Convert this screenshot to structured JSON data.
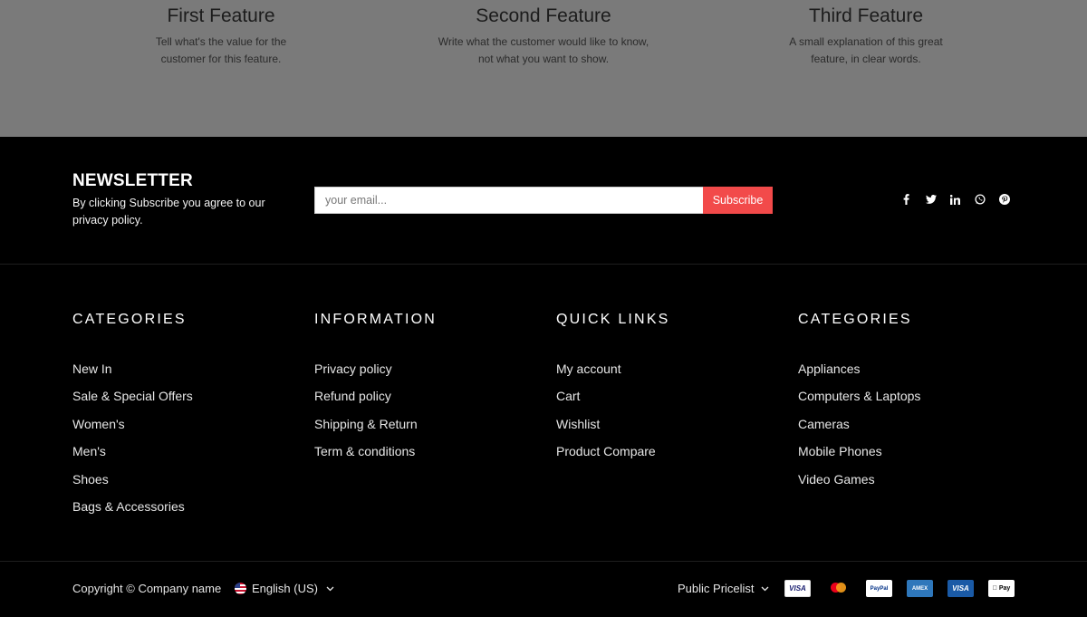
{
  "features": [
    {
      "title": "First Feature",
      "text": "Tell what's the value for the customer for this feature."
    },
    {
      "title": "Second Feature",
      "text": "Write what the customer would like to know, not what you want to show."
    },
    {
      "title": "Third Feature",
      "text": "A small explanation of this great feature, in clear words."
    }
  ],
  "newsletter": {
    "title": "NEWSLETTER",
    "text": "By clicking Subscribe you agree to our privacy policy.",
    "placeholder": "your email...",
    "button": "Subscribe"
  },
  "social": [
    "facebook-icon",
    "twitter-icon",
    "linkedin-icon",
    "whatsapp-icon",
    "pinterest-icon"
  ],
  "columns": [
    {
      "title": "CATEGORIES",
      "items": [
        "New In",
        "Sale & Special Offers",
        "Women's",
        "Men's",
        "Shoes",
        "Bags & Accessories"
      ]
    },
    {
      "title": "INFORMATION",
      "items": [
        "Privacy policy",
        "Refund policy",
        "Shipping & Return",
        "Term & conditions"
      ]
    },
    {
      "title": "QUICK LINKS",
      "items": [
        "My account",
        "Cart",
        "Wishlist",
        "Product Compare"
      ]
    },
    {
      "title": "CATEGORIES",
      "items": [
        "Appliances",
        "Computers & Laptops",
        "Cameras",
        "Mobile Phones",
        "Video Games"
      ]
    }
  ],
  "bottom": {
    "copyright": "Copyright © Company name",
    "language": "English (US)",
    "pricelist": "Public Pricelist",
    "payments": [
      {
        "name": "visa-icon",
        "label": "VISA"
      },
      {
        "name": "mastercard-icon",
        "label": ""
      },
      {
        "name": "paypal-icon",
        "label": "PayPal"
      },
      {
        "name": "amex-icon",
        "label": "AMEX"
      },
      {
        "name": "visa-blue-icon",
        "label": "VISA"
      },
      {
        "name": "apple-pay-icon",
        "label": "Pay"
      }
    ]
  },
  "colors": {
    "accent": "#f24a4a",
    "feature_band": "#7a7a7a",
    "footer_bg": "#000000"
  }
}
